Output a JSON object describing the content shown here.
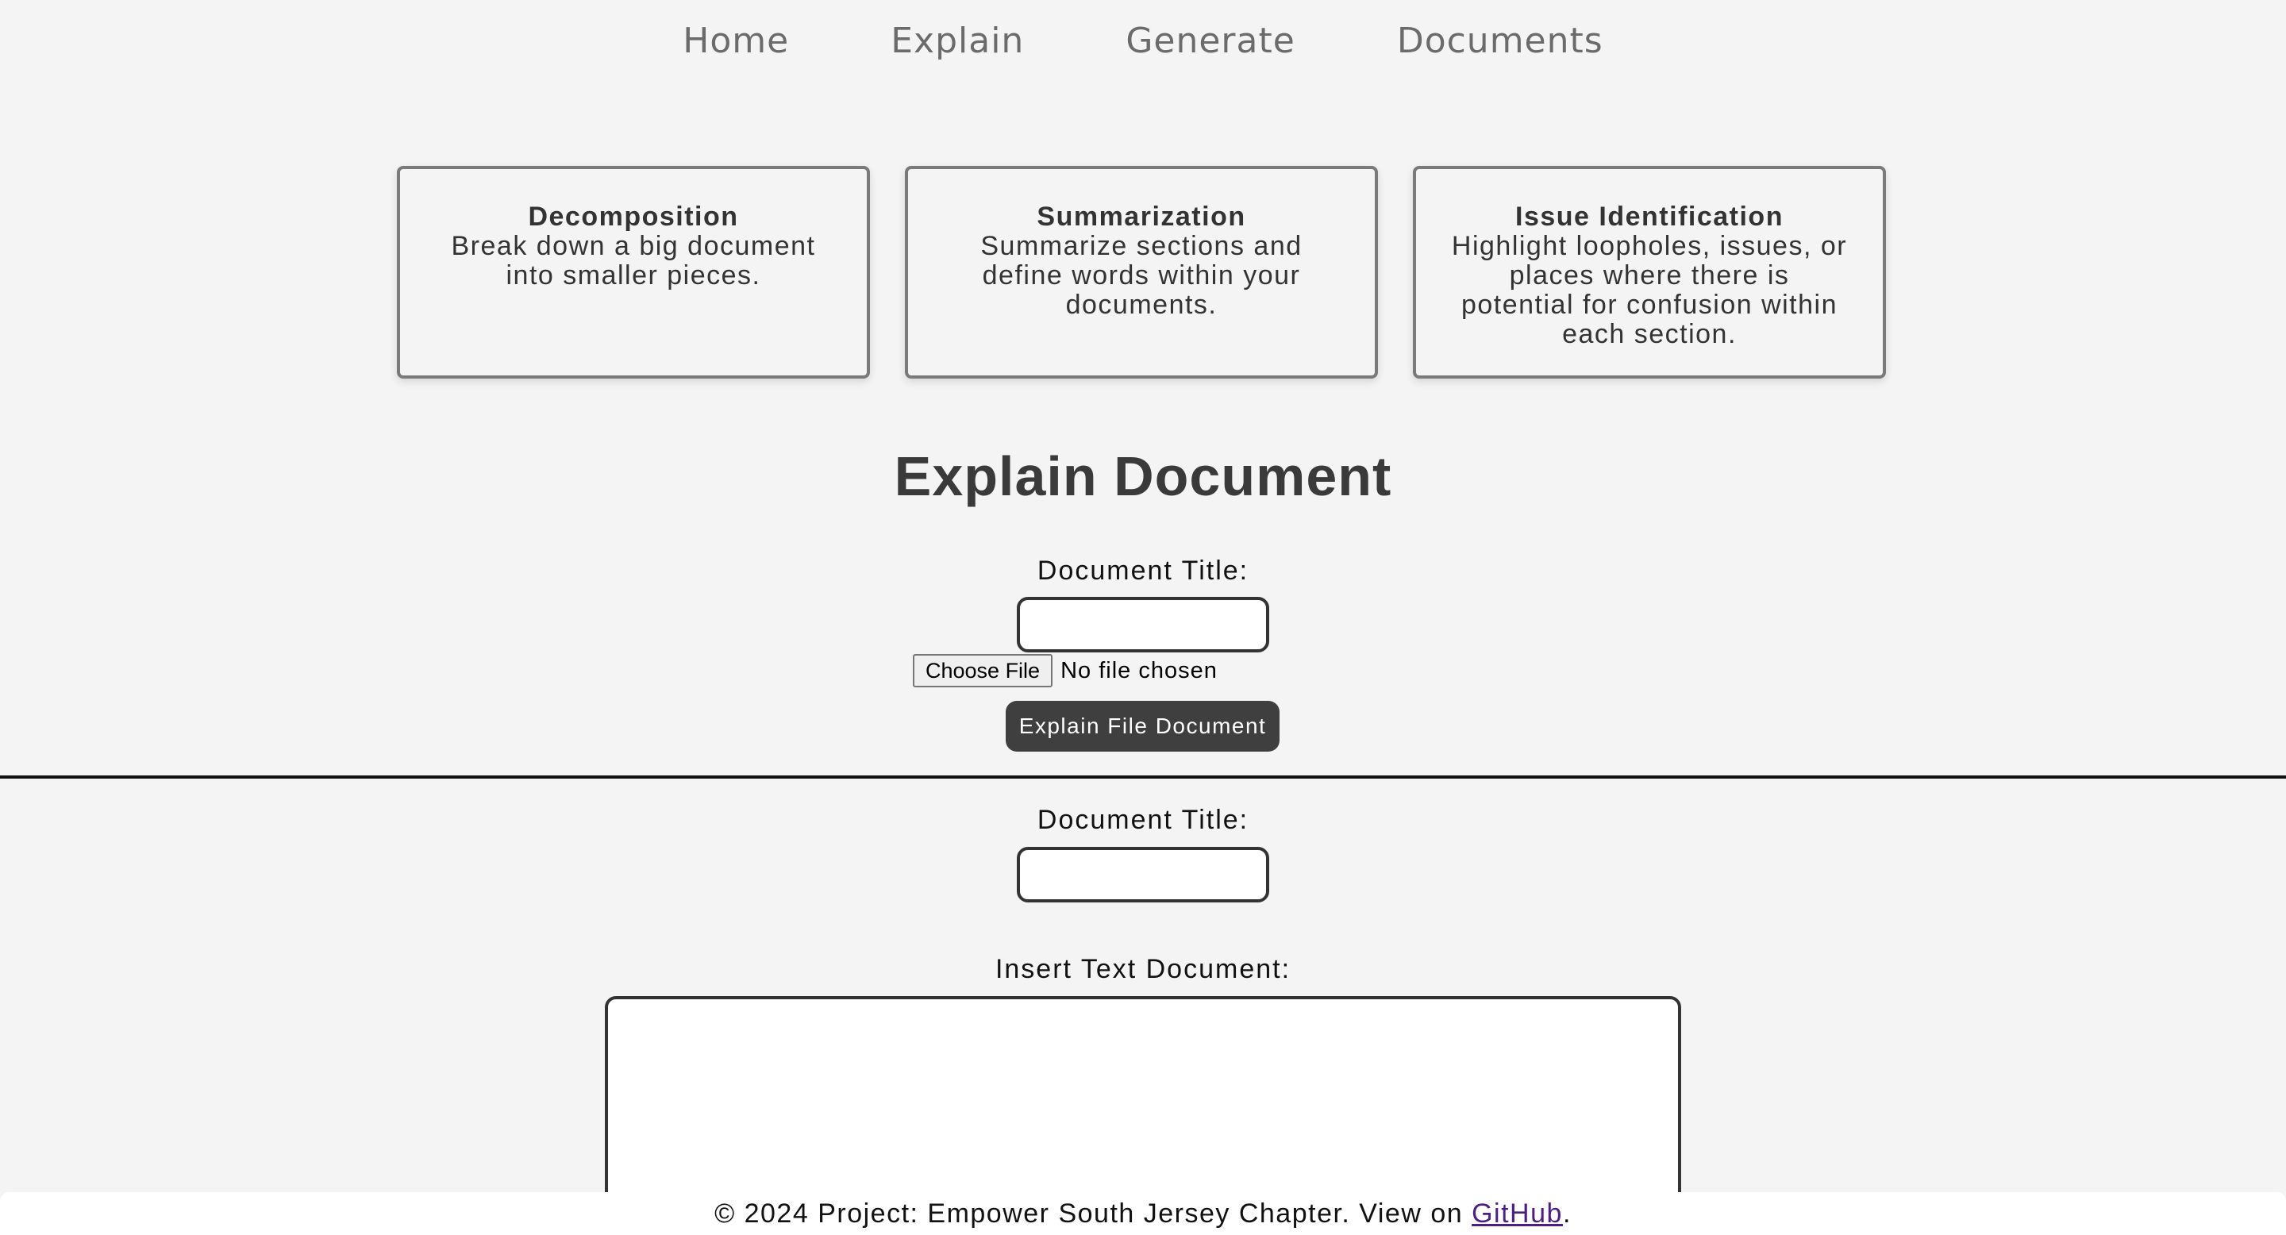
{
  "nav": {
    "items": [
      {
        "label": "Home"
      },
      {
        "label": "Explain"
      },
      {
        "label": "Generate"
      },
      {
        "label": "Documents"
      }
    ]
  },
  "cards": [
    {
      "title": "Decomposition",
      "desc": "Break down a big document into smaller pieces."
    },
    {
      "title": "Summarization",
      "desc": "Summarize sections and define words within your documents."
    },
    {
      "title": "Issue Identification",
      "desc": "Highlight loopholes, issues, or places where there is potential for confusion within each section."
    }
  ],
  "main": {
    "heading": "Explain Document",
    "file_form": {
      "title_label": "Document Title:",
      "choose_file_label": "Choose File",
      "file_status": "No file chosen",
      "submit_label": "Explain File Document"
    },
    "text_form": {
      "title_label": "Document Title:",
      "text_label": "Insert Text Document:"
    }
  },
  "footer": {
    "text": "© 2024 Project: Empower South Jersey Chapter. View on ",
    "link_label": "GitHub",
    "suffix": "."
  },
  "colors": {
    "background": "#f4f4f4",
    "button_dark": "#3f3f3f",
    "link": "#4b1f87"
  }
}
